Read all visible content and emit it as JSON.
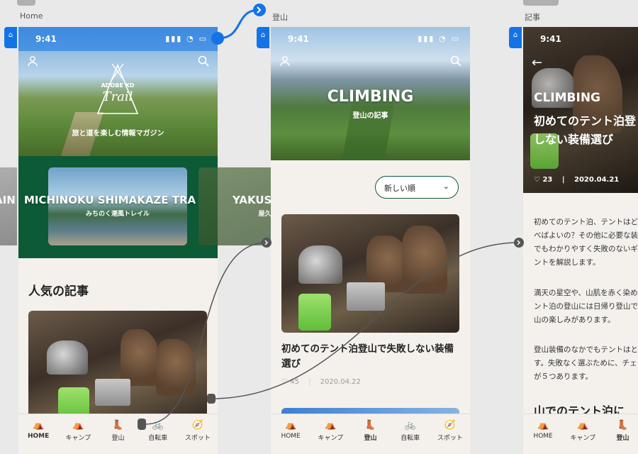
{
  "artboards": {
    "home": {
      "label": "Home"
    },
    "climbing": {
      "label": "登山"
    },
    "article": {
      "label": "記事"
    }
  },
  "status": {
    "time": "9:41",
    "icons": "▮▮▮ ◔ ▭"
  },
  "home": {
    "logo_line1": "ADOBE XD",
    "logo_line2": "Trail",
    "tagline": "旅と道を楽しむ情報マガジン",
    "carousel": [
      {
        "title": "AIN",
        "subtitle": ""
      },
      {
        "title": "MICHINOKU SHIMAKAZE TRA",
        "subtitle": "みちのく潮風トレイル"
      },
      {
        "title": "YAKUSHIMA",
        "subtitle": "屋久島"
      }
    ],
    "section_title": "人気の記事"
  },
  "climbing": {
    "hero_title": "CLIMBING",
    "hero_subtitle": "登山の記事",
    "sort_label": "新しい順",
    "card": {
      "title": "初めてのテント泊登山で失敗しない装備選び",
      "likes": "45",
      "date": "2020.04.22"
    }
  },
  "article": {
    "category": "CLIMBING",
    "title": "初めてのテント泊登山で失敗しない装備選び",
    "title_visible": "初めてのテント泊登\nしない装備選び",
    "likes": "23",
    "date": "2020.04.21",
    "paragraphs": [
      "初めてのテント泊、テントはどれを選\nべばよいの？その他に必要な装備は？初\nでもわかりやすく失敗のないギアの選び\nントを解説します。",
      "満天の星空や、山肌を赤く染める朝\nント泊の登山には日帰り登山では味わ\n山の楽しみがあります。",
      "登山装備のなかでもテントはとくに\nす。失敗なく選ぶために、チェックし\nが５つあります。"
    ],
    "heading": "山でのテント泊に"
  },
  "tabs": [
    {
      "label": "HOME",
      "icon": "tent-icon"
    },
    {
      "label": "キャンプ",
      "icon": "camp-icon"
    },
    {
      "label": "登山",
      "icon": "boot-icon"
    },
    {
      "label": "自転車",
      "icon": "bike-icon"
    },
    {
      "label": "スポット",
      "icon": "compass-icon"
    }
  ],
  "colors": {
    "accent_green": "#0c5a36",
    "tab_active": "#2f7d6e",
    "selection_blue": "#1473e6"
  }
}
